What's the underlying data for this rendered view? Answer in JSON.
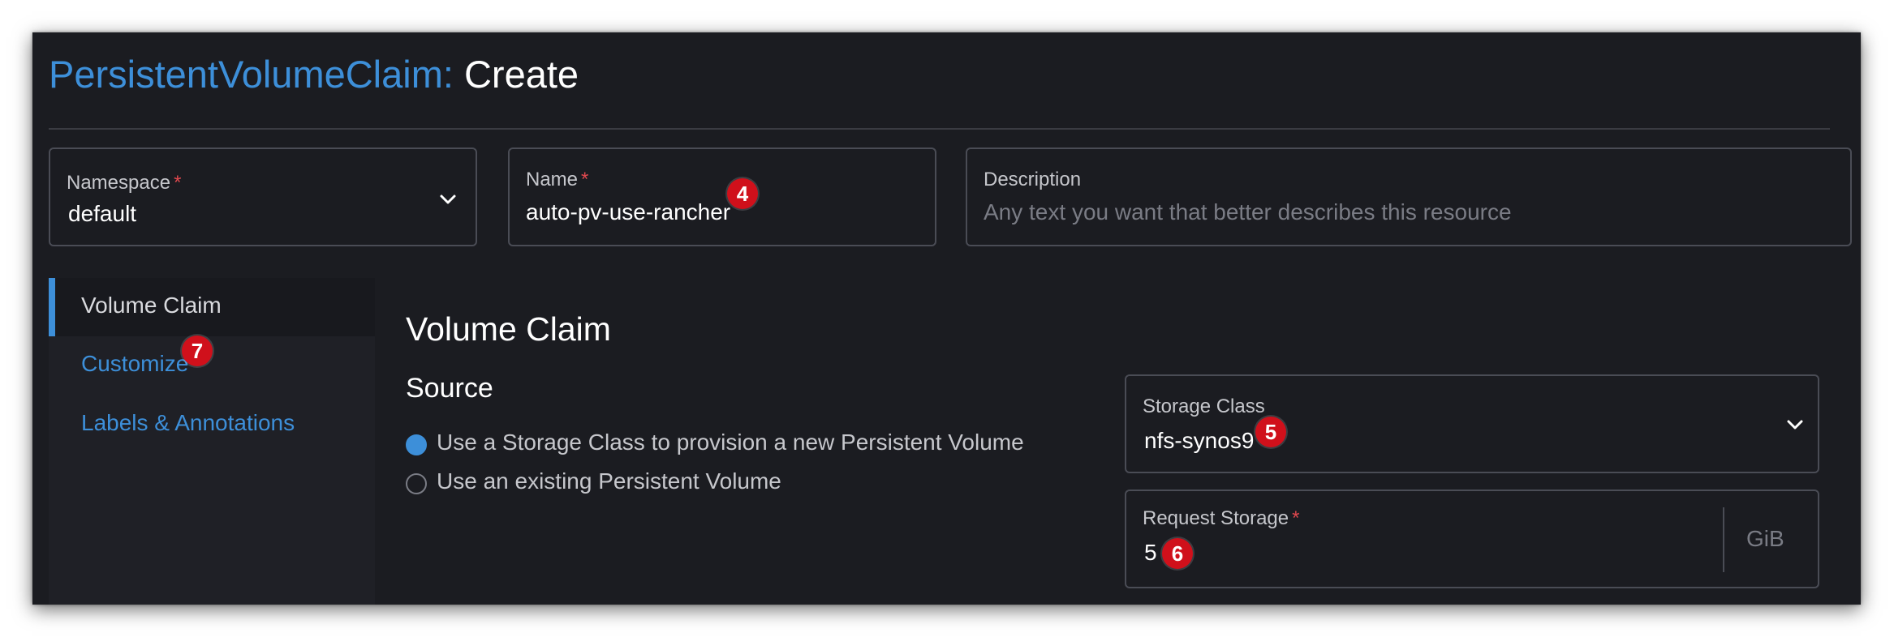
{
  "header": {
    "resource_type": "PersistentVolumeClaim:",
    "action": "Create"
  },
  "namespace": {
    "label": "Namespace",
    "required_mark": "*",
    "value": "default"
  },
  "name": {
    "label": "Name",
    "required_mark": "*",
    "value": "auto-pv-use-rancher"
  },
  "description": {
    "label": "Description",
    "placeholder": "Any text you want that better describes this resource"
  },
  "sidebar": {
    "items": [
      {
        "label": "Volume Claim"
      },
      {
        "label": "Customize"
      },
      {
        "label": "Labels & Annotations"
      }
    ]
  },
  "main": {
    "title": "Volume Claim",
    "source_title": "Source",
    "source_options": [
      {
        "label": "Use a Storage Class to provision a new Persistent Volume",
        "selected": true
      },
      {
        "label": "Use an existing Persistent Volume",
        "selected": false
      }
    ]
  },
  "storage_class": {
    "label": "Storage Class",
    "value": "nfs-synos9"
  },
  "request_storage": {
    "label": "Request Storage",
    "required_mark": "*",
    "value": "5",
    "unit": "GiB"
  },
  "annotations": {
    "badge4": "4",
    "badge5": "5",
    "badge6": "6",
    "badge7": "7"
  },
  "colors": {
    "accent": "#3d8fd9",
    "badge": "#d0101b",
    "background": "#1b1c21"
  }
}
